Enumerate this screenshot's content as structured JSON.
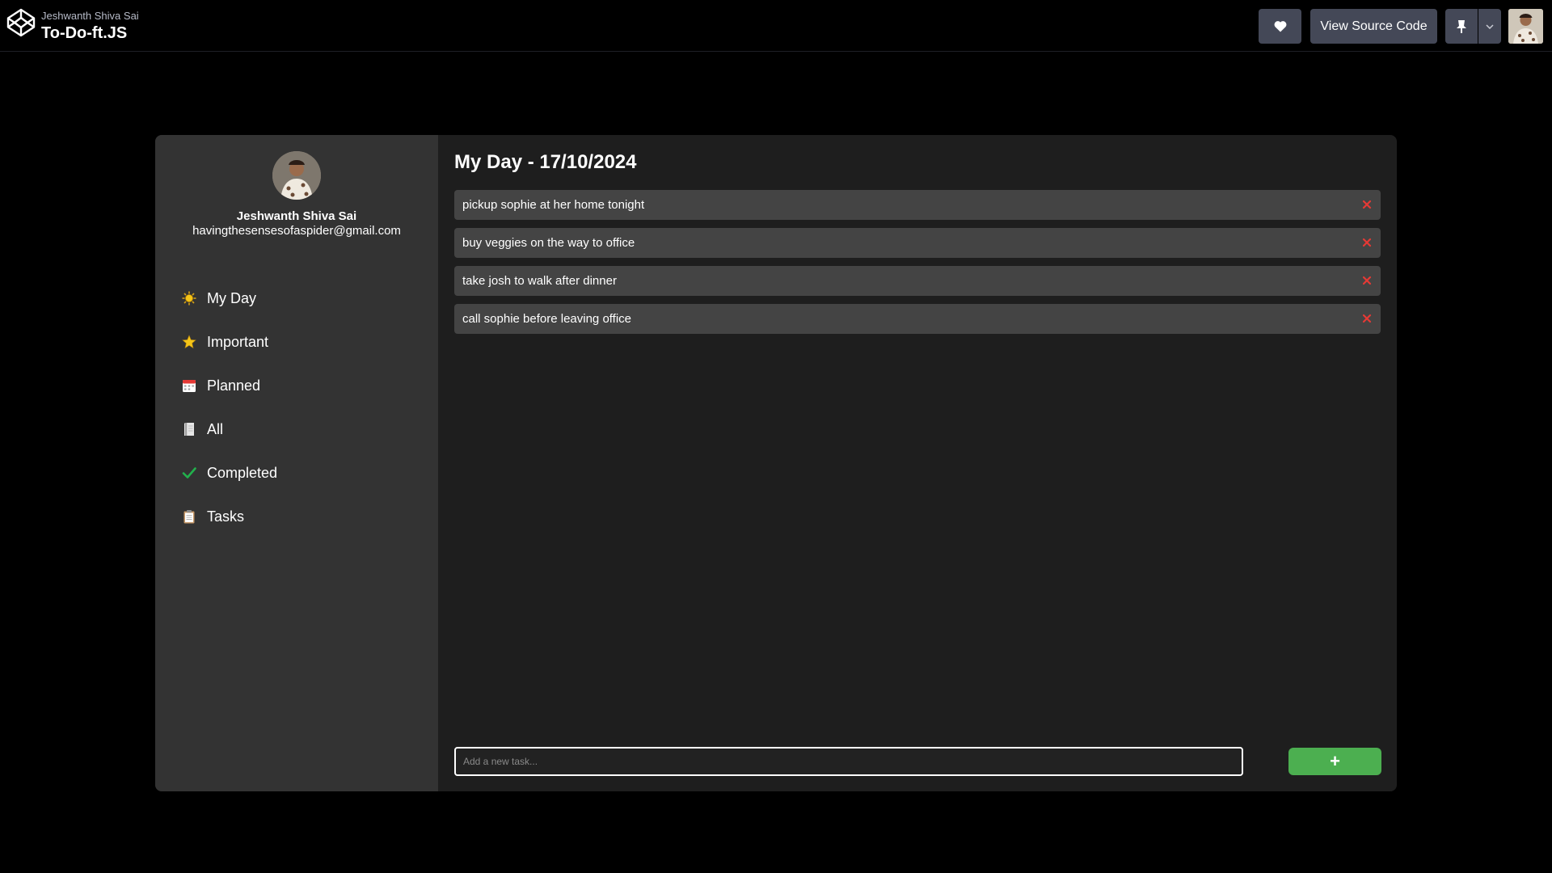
{
  "header": {
    "author": "Jeshwanth Shiva Sai",
    "title": "To-Do-ft.JS",
    "view_source_label": "View Source Code",
    "icons": [
      "codepen-logo-icon",
      "heart-icon",
      "pin-icon",
      "chevron-down-icon"
    ]
  },
  "profile": {
    "name": "Jeshwanth Shiva Sai",
    "email": "havingthesensesofaspider@gmail.com"
  },
  "sidebar": {
    "items": [
      {
        "label": "My Day",
        "icon": "sun-icon"
      },
      {
        "label": "Important",
        "icon": "star-icon"
      },
      {
        "label": "Planned",
        "icon": "calendar-icon"
      },
      {
        "label": "All",
        "icon": "document-icon"
      },
      {
        "label": "Completed",
        "icon": "check-icon"
      },
      {
        "label": "Tasks",
        "icon": "clipboard-icon"
      }
    ]
  },
  "main": {
    "title": "My Day - 17/10/2024",
    "tasks": [
      "pickup sophie at her home tonight",
      "buy veggies on the way to office",
      "take josh to walk after dinner",
      "call sophie before leaving office"
    ],
    "input_placeholder": "Add a new task...",
    "add_label": "+"
  },
  "colors": {
    "page_bg": "#000000",
    "sidebar_bg": "#333333",
    "main_bg": "#1e1e1e",
    "task_bg": "#444444",
    "add_button": "#4caf50",
    "delete_icon": "#e53935",
    "topbar_button": "#444857"
  }
}
